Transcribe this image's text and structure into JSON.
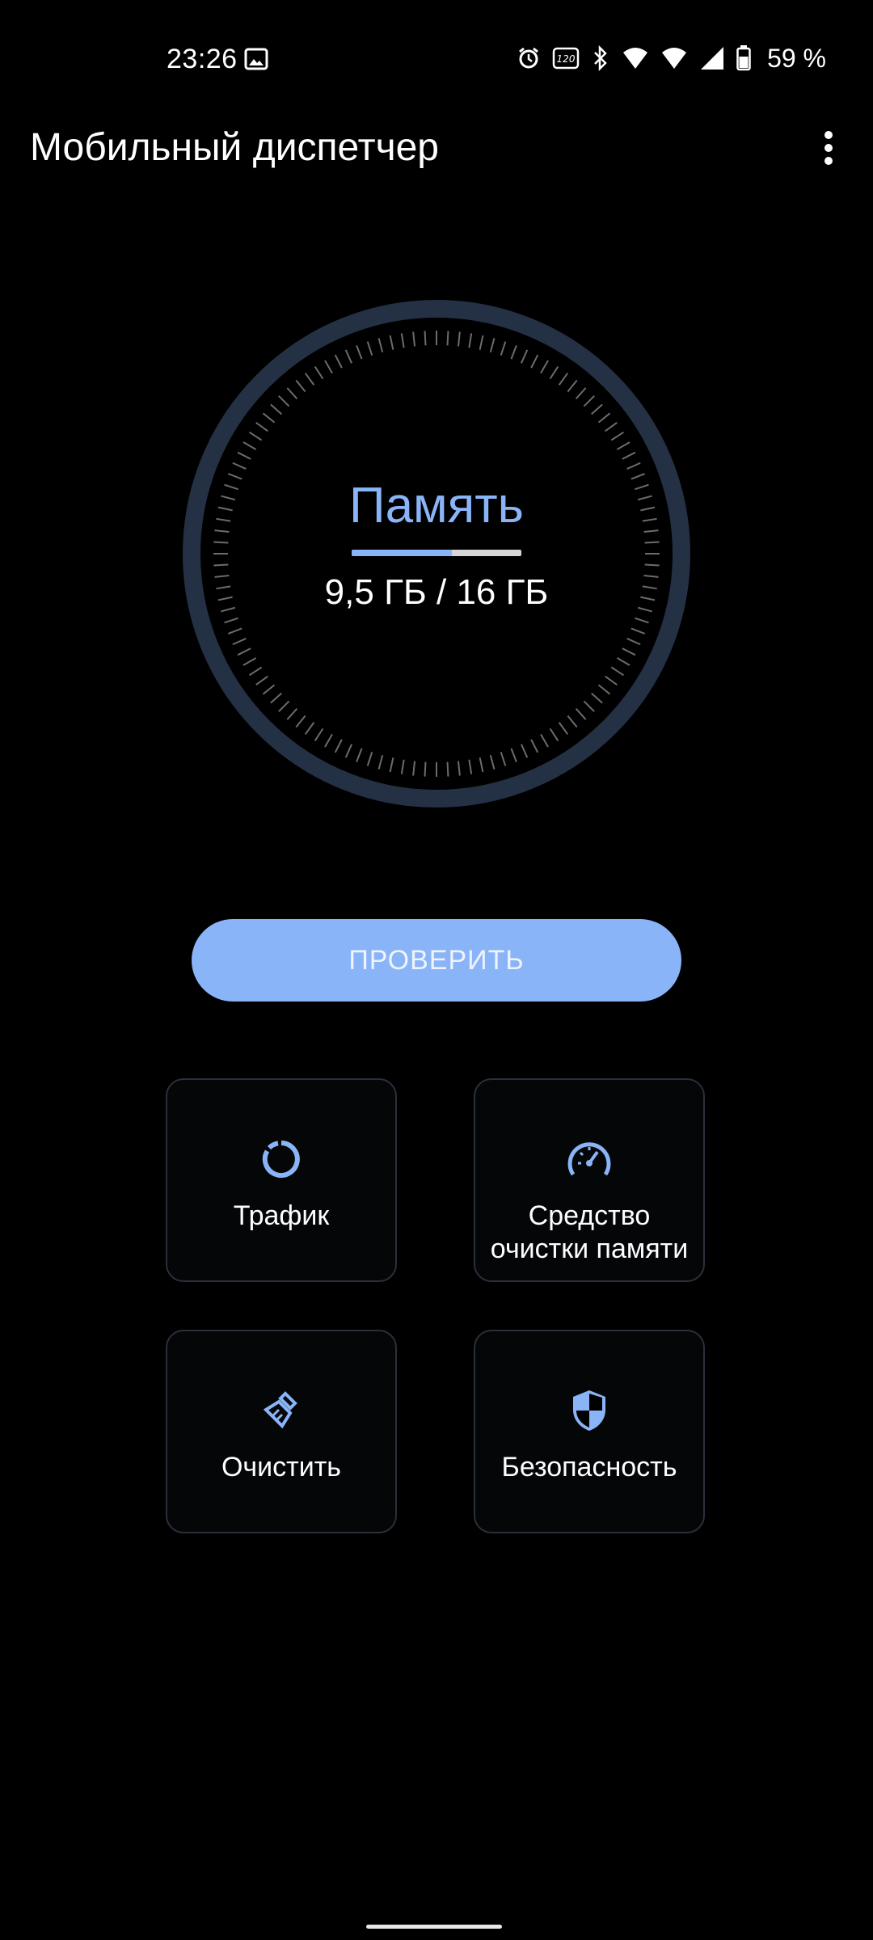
{
  "status_bar": {
    "time": "23:26",
    "battery": "59 %",
    "icons": [
      "gallery-icon",
      "alarm-icon",
      "refresh-rate-120-icon",
      "bluetooth-icon",
      "wifi6-icon",
      "wifi6-icon",
      "cellular-signal-icon",
      "battery-icon"
    ]
  },
  "app_bar": {
    "title": "Мобильный диспетчер",
    "menu_icon": "more-vert-icon"
  },
  "gauge": {
    "label": "Память",
    "value_text": "9,5 ГБ / 16 ГБ",
    "used_fraction": 0.59
  },
  "check_button": {
    "label": "ПРОВЕРИТЬ"
  },
  "tiles": [
    {
      "label": "Трафик",
      "icon": "data-usage-icon"
    },
    {
      "label": "Средство очистки памяти",
      "icon": "speedometer-icon"
    },
    {
      "label": "Очистить",
      "icon": "broom-icon"
    },
    {
      "label": "Безопасность",
      "icon": "shield-icon"
    }
  ],
  "colors": {
    "accent": "#8ab4f8",
    "background": "#000000",
    "gauge_ring": "#243044",
    "tile_border": "#2a2f3a"
  }
}
